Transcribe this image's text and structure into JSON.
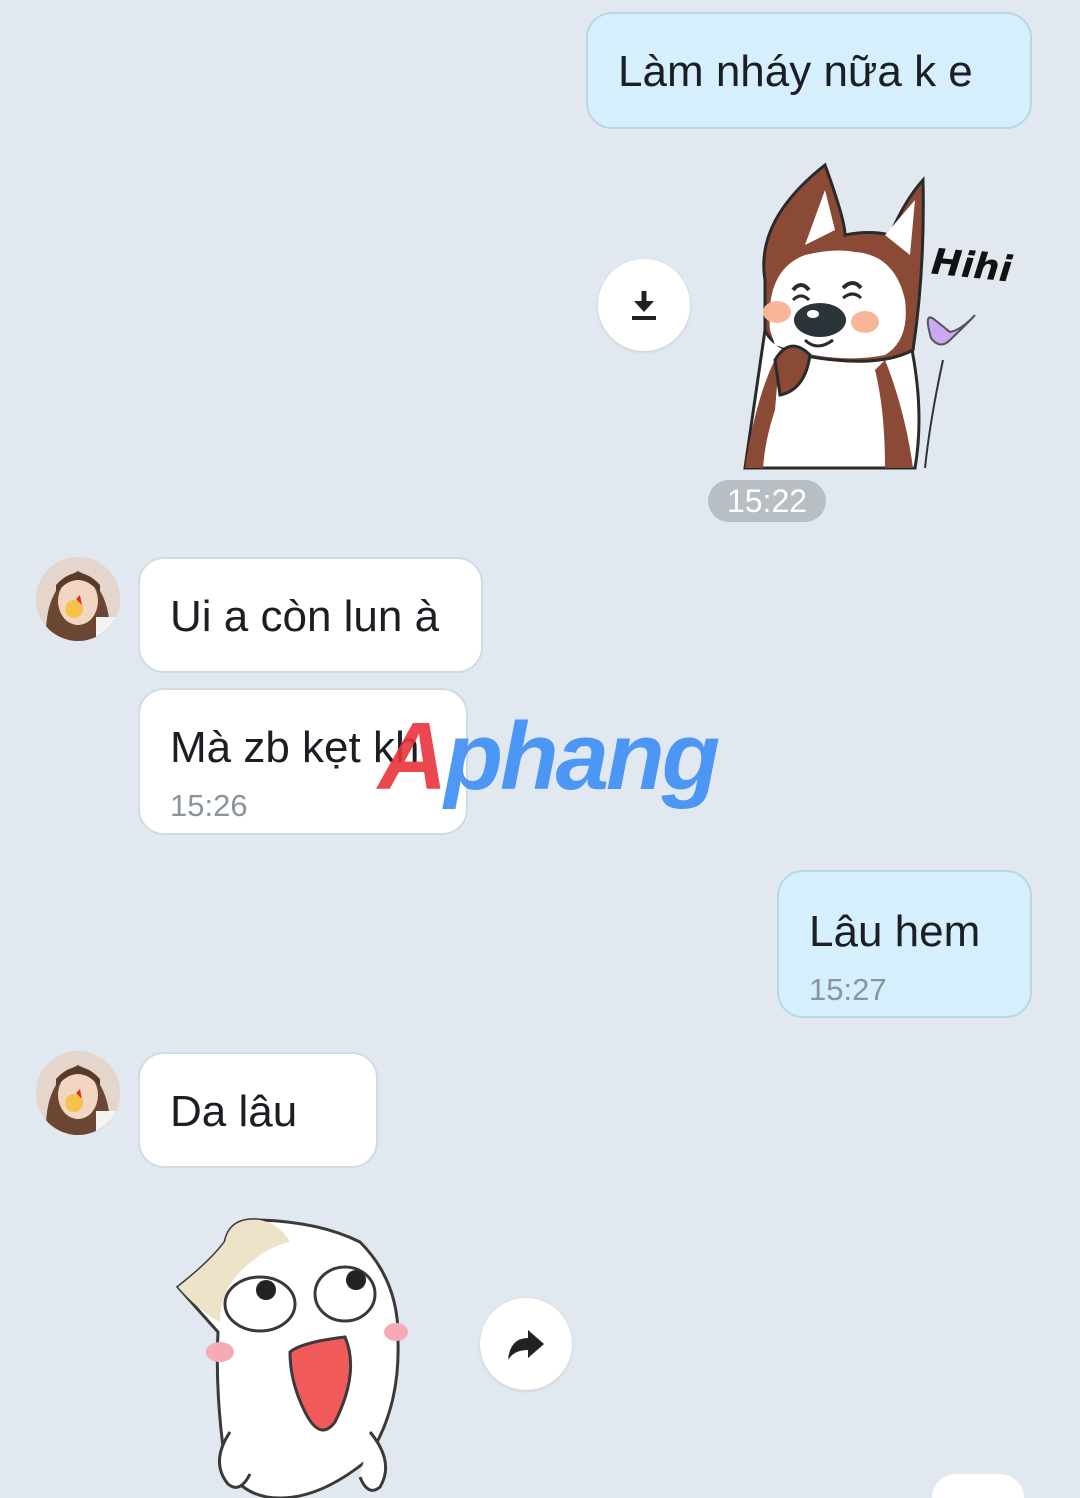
{
  "messages": [
    {
      "text": "Làm nháy nữa k e"
    },
    {
      "sticker": "husky-hihi-sticker",
      "sticker_text": "Hihi",
      "time": "15:22"
    },
    {
      "text": "Ui a còn lun à"
    },
    {
      "text": "Mà zb kẹt kh",
      "time": "15:26"
    },
    {
      "text": "Lâu hem",
      "time": "15:27"
    },
    {
      "text": "Da lâu"
    },
    {
      "sticker": "white-cat-sticker"
    }
  ],
  "watermark": {
    "text": "Aphang"
  },
  "colors": {
    "background": "#e1e8ef",
    "outgoing_bubble": "#d5effd",
    "incoming_bubble": "#ffffff",
    "time_chip": "#b7bec4",
    "watermark_red": "#e8353b",
    "watermark_blue": "#3d8ff5"
  },
  "icons": {
    "download": "download-icon",
    "forward": "forward-icon"
  }
}
